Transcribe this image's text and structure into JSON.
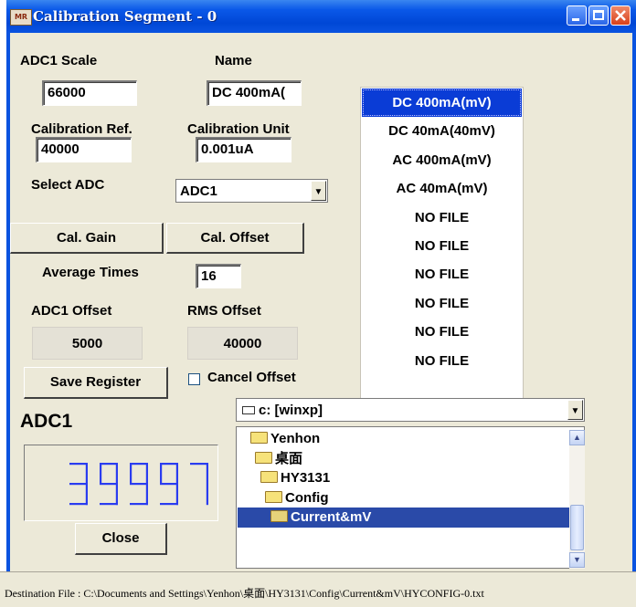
{
  "window": {
    "title": "Calibration Segment - 0",
    "icon_text": "MR"
  },
  "labels": {
    "adc1_scale": "ADC1 Scale",
    "name": "Name",
    "calibration_ref": "Calibration Ref.",
    "calibration_unit": "Calibration Unit",
    "select_adc": "Select ADC",
    "average_times": "Average Times",
    "adc1_offset": "ADC1 Offset",
    "rms_offset": "RMS Offset",
    "cancel_offset": "Cancel Offset",
    "adc1_title": "ADC1"
  },
  "fields": {
    "adc1_scale": "66000",
    "name": "DC 400mA(",
    "calibration_ref": "40000",
    "calibration_unit": "0.001uA",
    "select_adc": "ADC1",
    "average_times": "16",
    "adc1_offset_value": "5000",
    "rms_offset_value": "40000"
  },
  "buttons": {
    "cal_gain": "Cal. Gain",
    "cal_offset": "Cal. Offset",
    "save_register": "Save Register",
    "close": "Close"
  },
  "segments_list": [
    "DC 400mA(mV)",
    "DC 40mA(40mV)",
    "AC 400mA(mV)",
    "AC 40mA(mV)",
    "NO FILE",
    "NO FILE",
    "NO FILE",
    "NO FILE",
    "NO FILE",
    "NO FILE"
  ],
  "selected_segment_index": 0,
  "lcd_reading": "39997",
  "drive_combo": "c: [winxp]",
  "folder_tree": [
    "Yenhon",
    "桌面",
    "HY3131",
    "Config",
    "Current&mV"
  ],
  "status": {
    "destination": "Destination File : C:\\Documents and Settings\\Yenhon\\桌面\\HY3131\\Config\\Current&mV\\HYCONFIG-0.txt"
  },
  "colors": {
    "title_bar": "#0a53e0",
    "selection": "#0a3cd6",
    "lcd_digits": "#2a3cf0"
  }
}
